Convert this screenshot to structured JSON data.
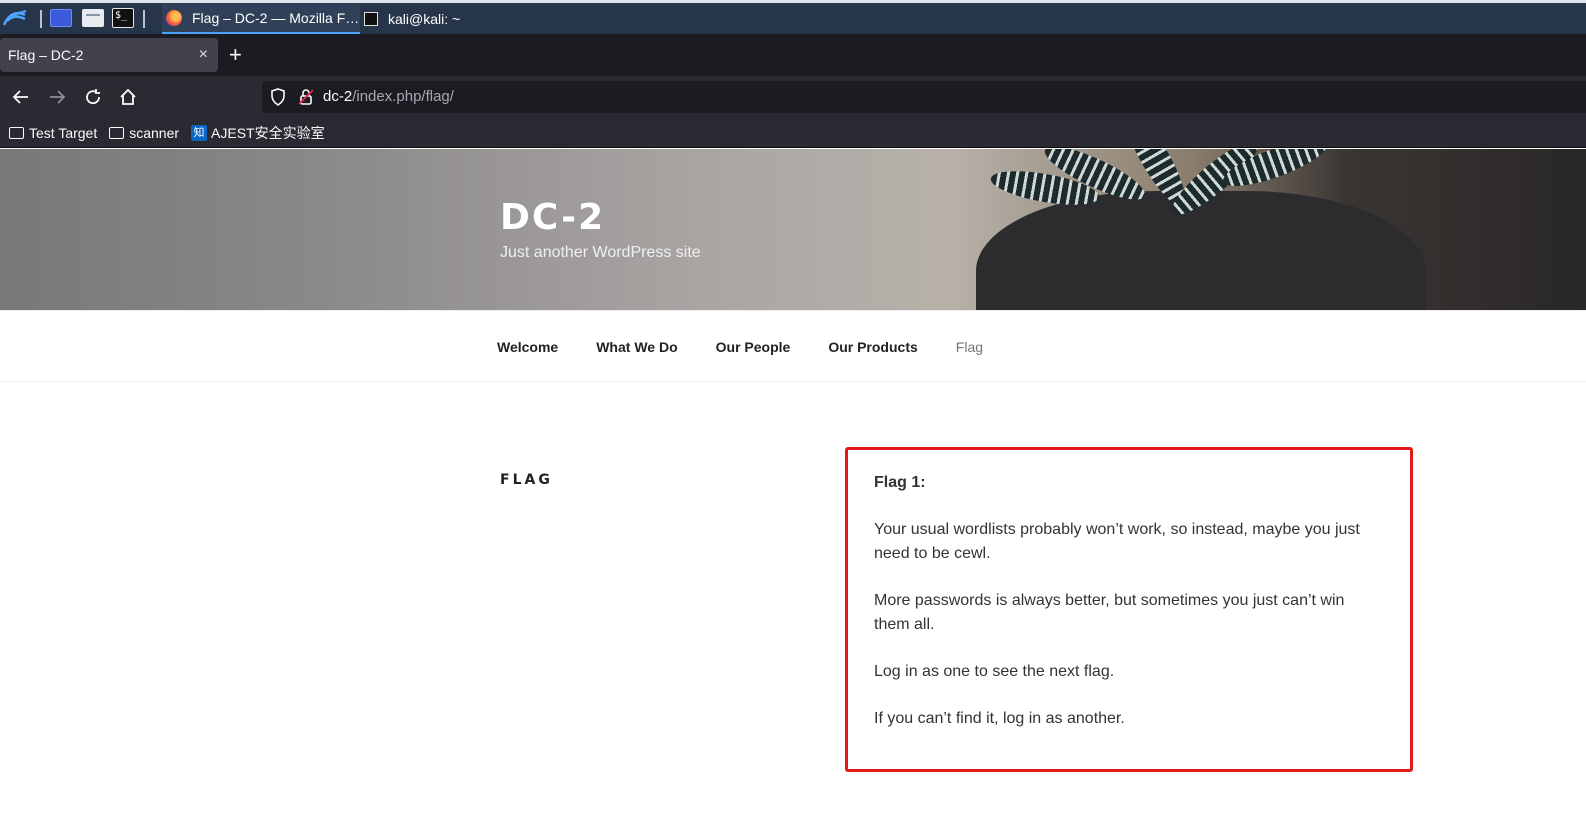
{
  "taskbar": {
    "tasks": [
      {
        "label": "Flag – DC-2 — Mozilla F…"
      },
      {
        "label": "kali@kali: ~"
      }
    ]
  },
  "browser": {
    "tab_title": "Flag – DC-2",
    "tab_close": "×",
    "new_tab": "+",
    "url_host": "dc-2",
    "url_path": "/index.php/flag/",
    "bookmarks": [
      {
        "label": "Test Target",
        "icon": "folder-icon"
      },
      {
        "label": "scanner",
        "icon": "folder-icon"
      },
      {
        "label": "AJEST安全实验室",
        "icon": "zhihu-icon"
      }
    ]
  },
  "site": {
    "title": "DC-2",
    "description": "Just another WordPress site",
    "nav": [
      "Welcome",
      "What We Do",
      "Our People",
      "Our Products",
      "Flag"
    ]
  },
  "page": {
    "title": "FLAG",
    "flag_heading": "Flag 1:",
    "paragraphs": [
      "Your usual wordlists probably won’t work, so instead, maybe you just need to be cewl.",
      "More passwords is always better, but sometimes you just can’t win them all.",
      "Log in as one to see the next flag.",
      "If you can’t find it, log in as another."
    ]
  },
  "colors": {
    "highlight_border": "#e31a1a",
    "taskbar_bg": "#27354a",
    "browser_bg": "#2b2a33"
  }
}
